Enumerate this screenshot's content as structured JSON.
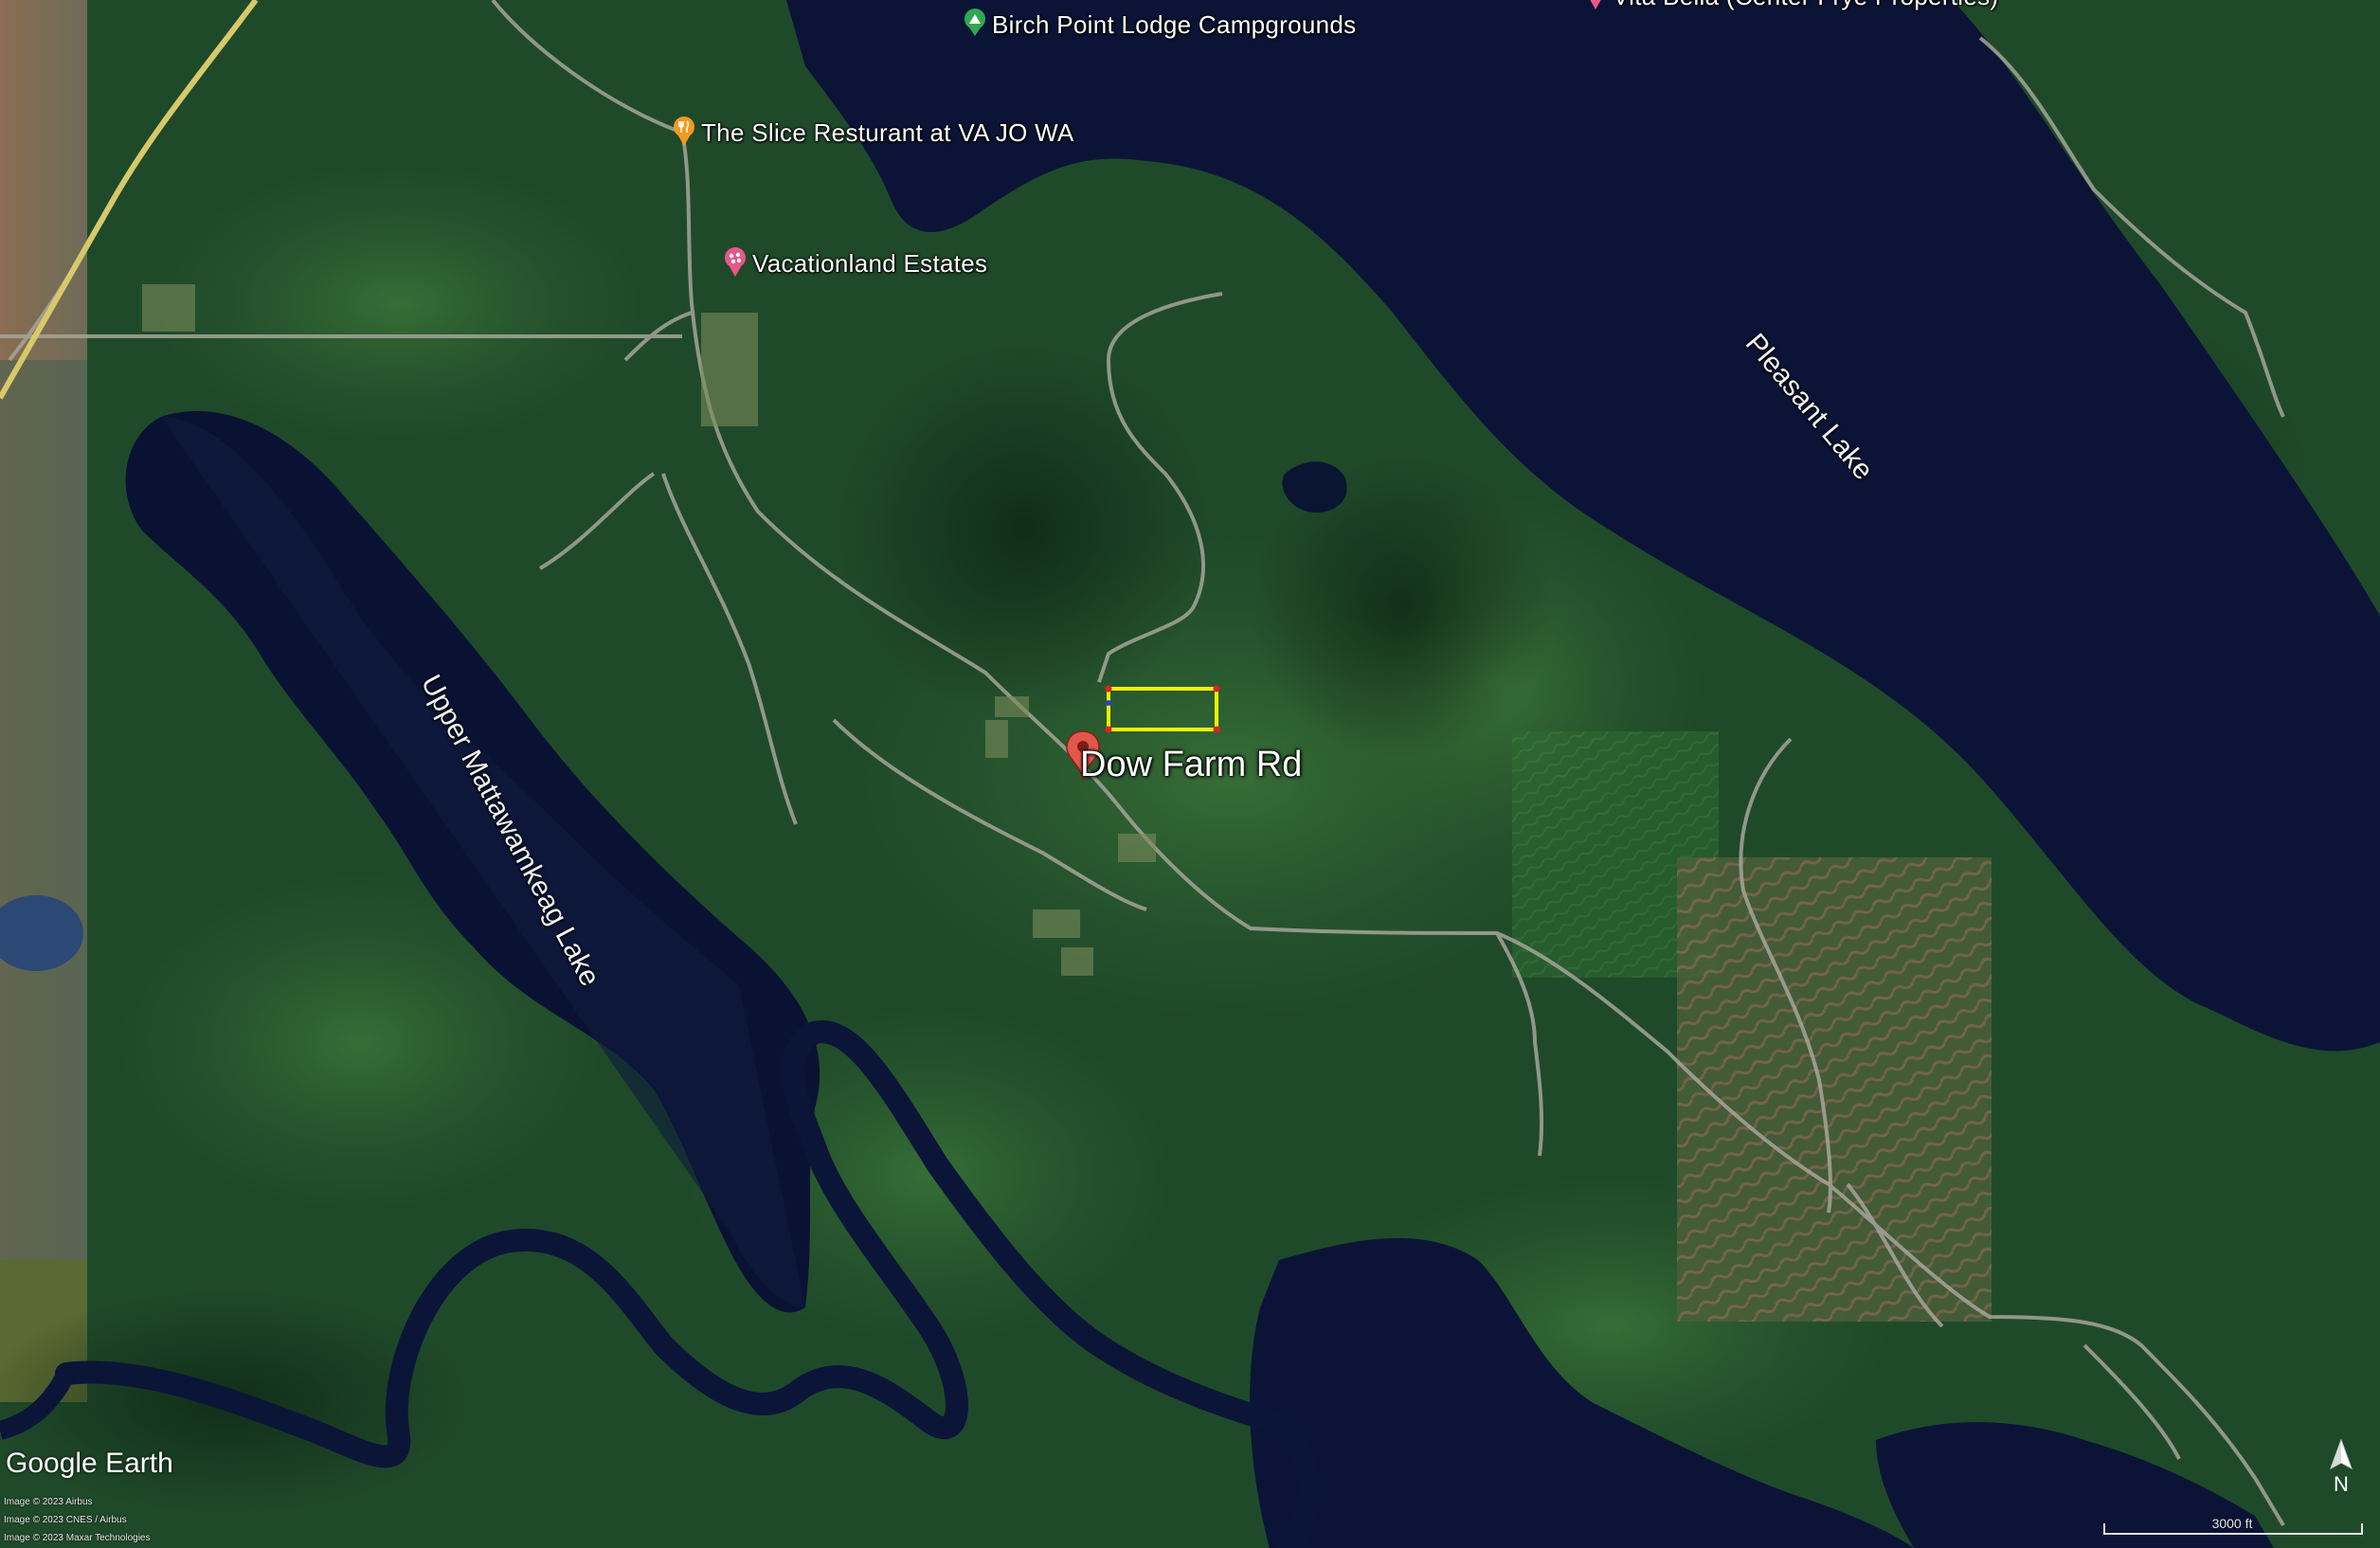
{
  "app": "Google Earth",
  "main_placemark": {
    "label": "Dow Farm Rd",
    "icon": "red-map-pin-icon"
  },
  "places": {
    "birch_point": {
      "label": "Birch Point Lodge Campgrounds",
      "icon": "campground-icon"
    },
    "vita_bella": {
      "label": "Vita Bella (Center Frye Properties)",
      "icon": "pink-map-pin-icon"
    },
    "the_slice": {
      "label": "The Slice Resturant at VA JO WA",
      "icon": "restaurant-icon"
    },
    "vacationland": {
      "label": "Vacationland Estates",
      "icon": "real-estate-icon"
    }
  },
  "water_labels": {
    "pleasant_lake": "Pleasant Lake",
    "upper_mattawamkeag": "Upper Mattawamkeag Lake"
  },
  "logo": "Google Earth",
  "credits": [
    "Image © 2023 Airbus",
    "Image © 2023 CNES / Airbus",
    "Image © 2023 Maxar Technologies"
  ],
  "scale_label": "3000 ft",
  "compass_label": "N",
  "colors": {
    "parcel_outline": "#f2f200",
    "parcel_corner": "#e02020",
    "main_pin": "#e2574c",
    "restaurant_pin": "#f29a1f",
    "campground_pin": "#2fa84f",
    "estate_pin": "#e8578a",
    "water": "#0b1436",
    "forest": "#1f4a2a"
  }
}
